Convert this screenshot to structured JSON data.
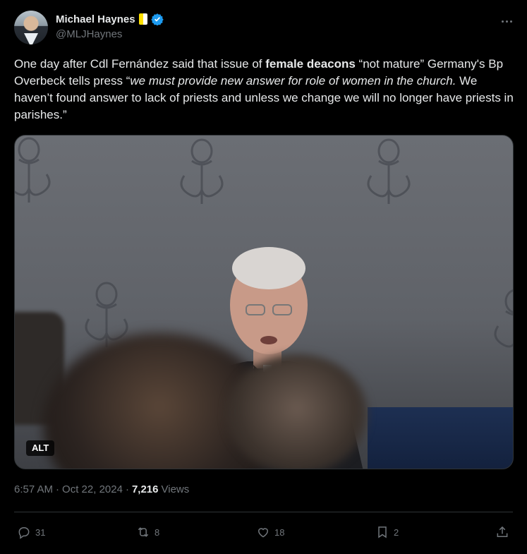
{
  "author": {
    "display_name": "Michael Haynes",
    "handle": "@MLJHaynes"
  },
  "tweet": {
    "text_part1": "One day after Cdl Fernández said that issue of ",
    "text_bold": "female deacons",
    "text_part2": " “not mature” Germany's Bp Overbeck tells press “",
    "text_italic": "we must provide new answer for role of women in the church.",
    "text_part3": " We haven’t found answer to lack of priests and unless we change we will no longer have priests in parishes.”"
  },
  "media": {
    "alt_badge": "ALT"
  },
  "meta": {
    "time": "6:57 AM",
    "separator1": "·",
    "date": "Oct 22, 2024",
    "separator2": "·",
    "views_count": "7,216",
    "views_label": "Views"
  },
  "actions": {
    "replies": "31",
    "reposts": "8",
    "likes": "18",
    "bookmarks": "2"
  },
  "icons": {
    "verified": "verified-badge-icon",
    "flag": "vatican-flag-icon",
    "more": "more-options-icon",
    "reply": "reply-icon",
    "repost": "repost-icon",
    "like": "heart-icon",
    "bookmark": "bookmark-icon",
    "share": "share-icon"
  },
  "colors": {
    "background": "#000000",
    "text": "#e7e9ea",
    "muted": "#71767b",
    "verified": "#1d9bf0",
    "border": "#2f3336"
  }
}
